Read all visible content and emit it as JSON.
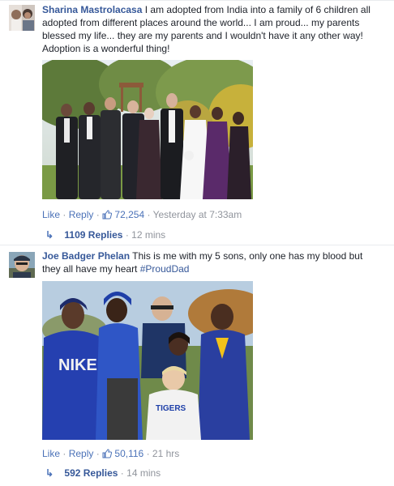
{
  "comments": [
    {
      "author": "Sharina Mastrolacasa",
      "text": "I am adopted from India into a family of 6 children all adopted from different places around the world... I am proud... my parents blessed my life... they are my parents and I wouldn't have it any other way! Adoption is a wonderful thing!",
      "tag": "",
      "like_label": "Like",
      "reply_label": "Reply",
      "like_count": "72,254",
      "timestamp": "Yesterday at 7:33am",
      "replies_label": "1109 Replies",
      "replies_time": "12 mins"
    },
    {
      "author": "Joe Badger Phelan",
      "text": "This is me with my 5 sons, only one has my blood but they all have my heart",
      "tag": "#ProudDad",
      "like_label": "Like",
      "reply_label": "Reply",
      "like_count": "50,116",
      "timestamp": "21 hrs",
      "replies_label": "592 Replies",
      "replies_time": "14 mins",
      "shirt_text_1": "NIKE",
      "shirt_text_2": "TIGERS"
    }
  ],
  "colors": {
    "link": "#365899",
    "action": "#4b72b8",
    "meta": "#90949c"
  }
}
